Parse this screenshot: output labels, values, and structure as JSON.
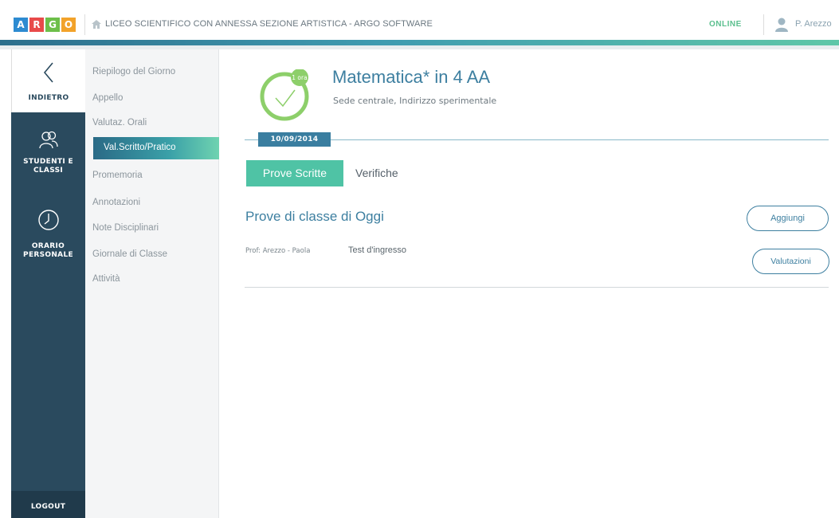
{
  "app": {
    "logo_letters": [
      "A",
      "R",
      "G",
      "O"
    ],
    "school_title": "LICEO SCIENTIFICO CON ANNESSA SEZIONE ARTISTICA - ARGO SOFTWARE",
    "status": "ONLINE",
    "user_name": "P. Arezzo"
  },
  "sidebar": {
    "back_label": "INDIETRO",
    "studenti_label_1": "STUDENTI E",
    "studenti_label_2": "CLASSI",
    "orario_label_1": "ORARIO",
    "orario_label_2": "PERSONALE",
    "logout_label": "LOGOUT"
  },
  "submenu": {
    "items": [
      "Riepilogo del Giorno",
      "Appello",
      "Valutaz. Orali",
      "Val.Scritto/Pratico",
      "Promemoria",
      "Annotazioni",
      "Note Disciplinari",
      "Giornale di Classe",
      "Attività"
    ],
    "active_index": 3
  },
  "lesson": {
    "hour_badge": "1 ora",
    "title": "Matematica* in 4 AA",
    "subtitle": "Sede centrale, Indirizzo sperimentale",
    "date": "10/09/2014"
  },
  "tabs": {
    "prove_scritte": "Prove Scritte",
    "verifiche": "Verifiche"
  },
  "section": {
    "title": "Prove di classe di Oggi",
    "add_button": "Aggiungi"
  },
  "rows": [
    {
      "teacher": "Prof: Arezzo - Paola",
      "test": "Test d'ingresso",
      "action": "Valutazioni"
    }
  ],
  "colors": {
    "sidebar_bg": "#2a4a5e",
    "accent": "#3d7fa0",
    "tab_active": "#4fc3a5",
    "online": "#5bbf8e"
  }
}
